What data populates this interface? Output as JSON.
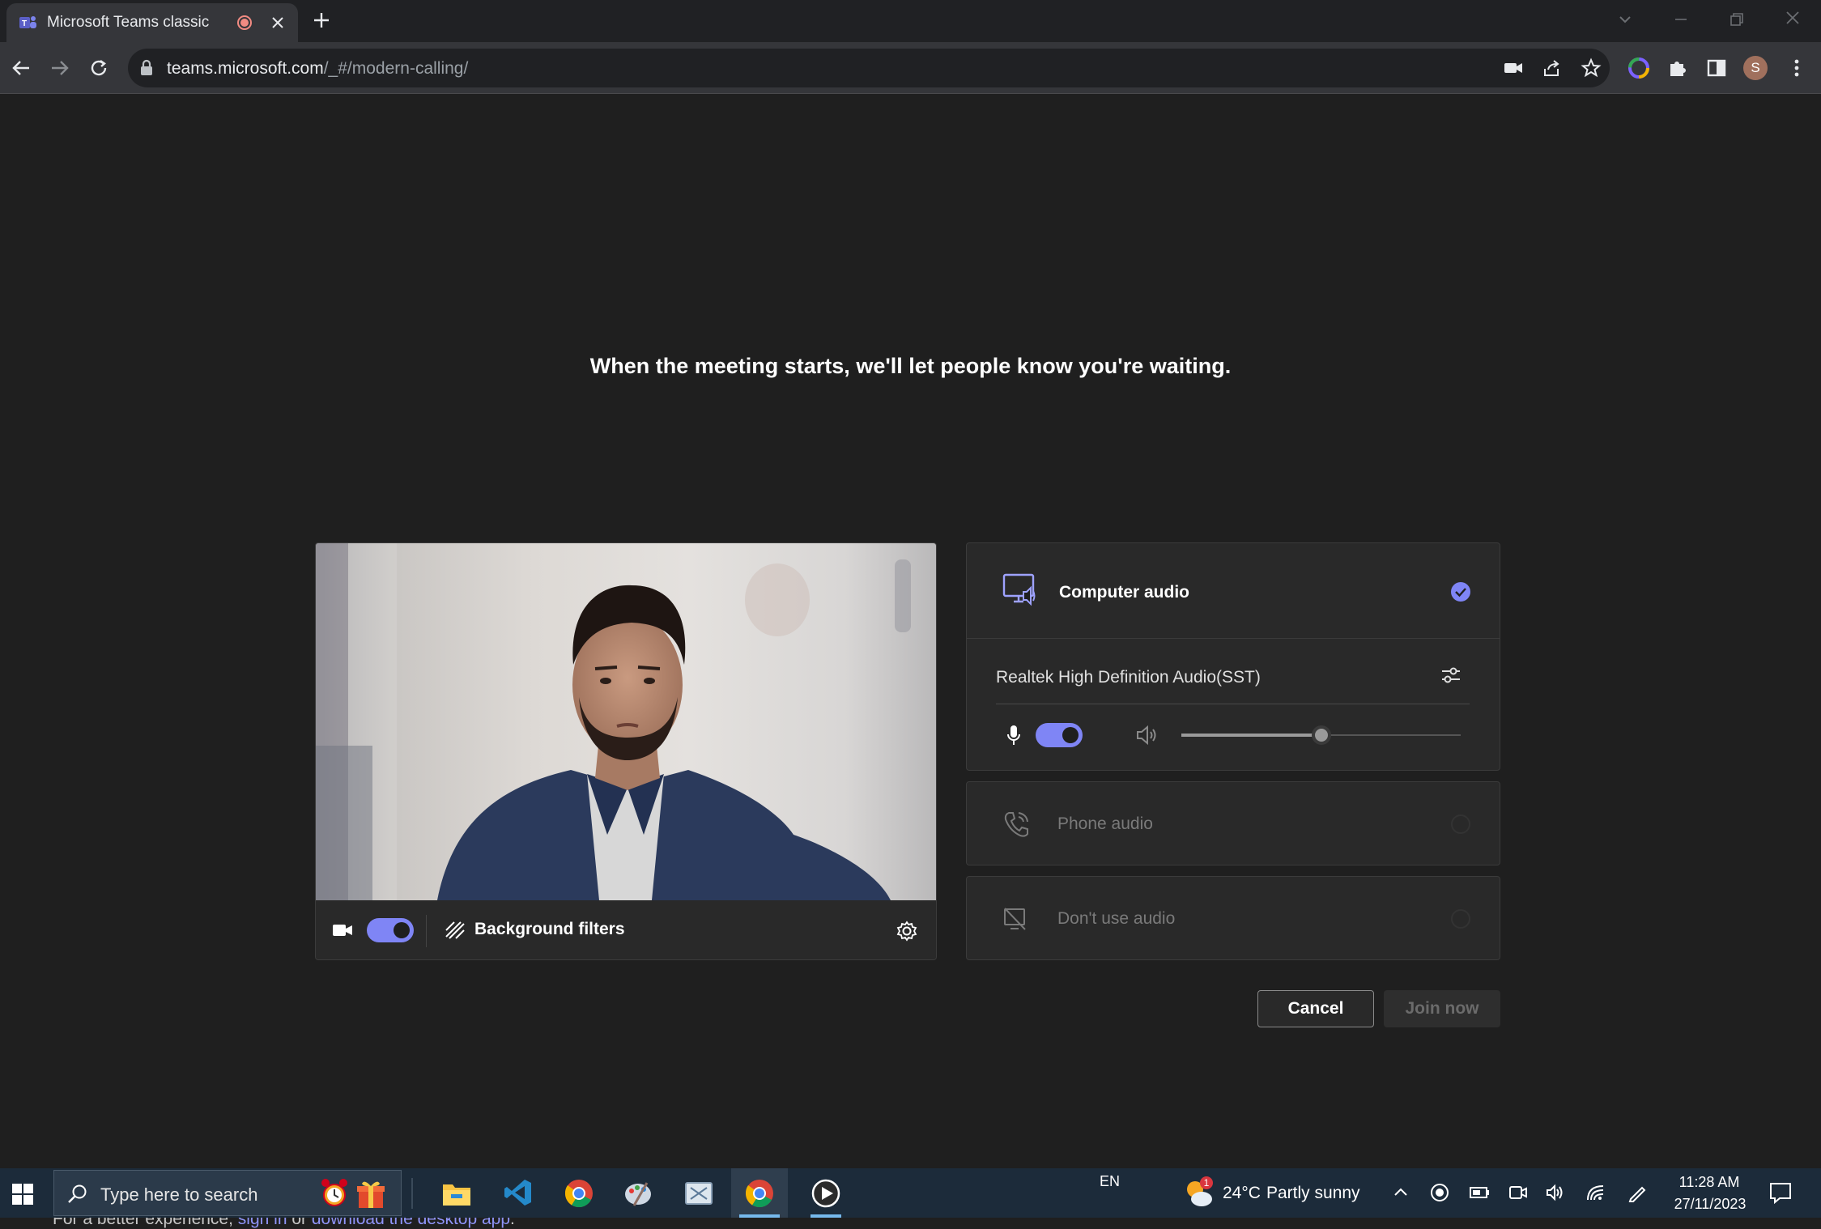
{
  "browser": {
    "tab_title": "Microsoft Teams classic",
    "url_host": "teams.microsoft.com",
    "url_path": "/_#/modern-calling/",
    "profile_initial": "S"
  },
  "prejoin": {
    "heading": "When the meeting starts, we'll let people know you're waiting.",
    "video": {
      "camera_on": true,
      "background_filters_label": "Background filters"
    },
    "audio_options": {
      "computer_audio": {
        "label": "Computer audio",
        "selected": true,
        "device_name": "Realtek High Definition Audio(SST)",
        "mic_on": true,
        "speaker_volume": 0.5
      },
      "phone_audio": {
        "label": "Phone audio",
        "selected": false
      },
      "no_audio": {
        "label": "Don't use audio",
        "selected": false
      }
    },
    "buttons": {
      "cancel": "Cancel",
      "join": "Join now"
    },
    "footer": {
      "prefix": "For a better experience, ",
      "sign_in": "sign in",
      "middle": " or ",
      "download": "download the desktop app",
      "suffix": "."
    }
  },
  "taskbar": {
    "search_placeholder": "Type here to search",
    "language": "EN",
    "weather_temp": "24°C",
    "weather_desc": "Partly sunny",
    "weather_badge": "1",
    "time": "11:28 AM",
    "date": "27/11/2023"
  },
  "colors": {
    "accent": "#7f85f5",
    "page_bg": "#1f1f1f",
    "card_bg": "#292929",
    "taskbar_bg": "#1c2b3a"
  }
}
